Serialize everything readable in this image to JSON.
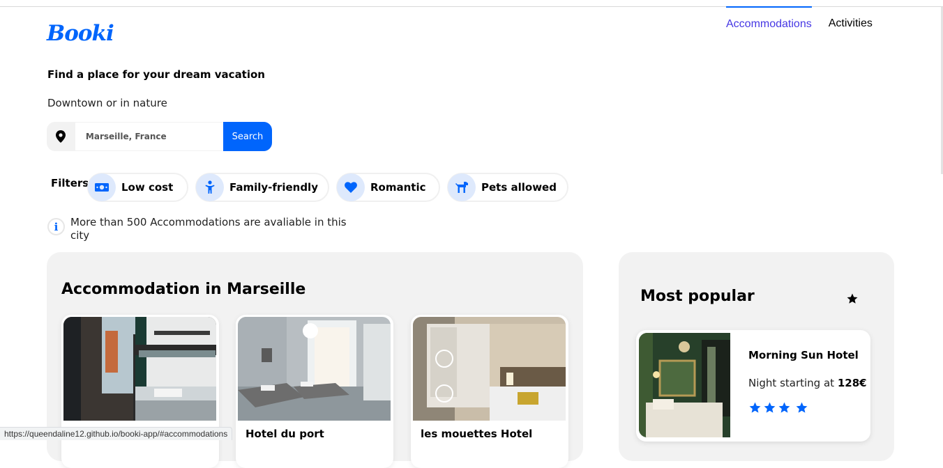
{
  "brand": {
    "logo": "Booki",
    "accent": "#0065fc"
  },
  "nav": [
    {
      "label": "Accommodations",
      "active": true
    },
    {
      "label": "Activities",
      "active": false
    }
  ],
  "hero": {
    "headline": "Find a place for your dream vacation",
    "subline": "Downtown or in nature"
  },
  "search": {
    "icon": "location-pin-icon",
    "value": "Marseille, France",
    "button_label": "Search"
  },
  "filters": {
    "label": "Filters",
    "items": [
      {
        "label": "Low cost",
        "icon": "money-icon"
      },
      {
        "label": "Family-friendly",
        "icon": "child-icon"
      },
      {
        "label": "Romantic",
        "icon": "heart-icon"
      },
      {
        "label": "Pets allowed",
        "icon": "dog-icon"
      }
    ]
  },
  "info": {
    "text": "More than 500 Accommodations are avaliable in this city"
  },
  "accommodations": {
    "title": "Accommodation in Marseille",
    "cards": [
      {
        "name": ""
      },
      {
        "name": "Hotel du port"
      },
      {
        "name": "les mouettes Hotel"
      }
    ]
  },
  "popular": {
    "title": "Most popular",
    "star_icon": "star-icon",
    "card": {
      "name": "Morning Sun Hotel",
      "price_prefix": "Night starting at",
      "price": "128€",
      "rating": 4
    }
  },
  "status_bar": {
    "url": "https://queendaline12.github.io/booki-app/#accommodations"
  }
}
